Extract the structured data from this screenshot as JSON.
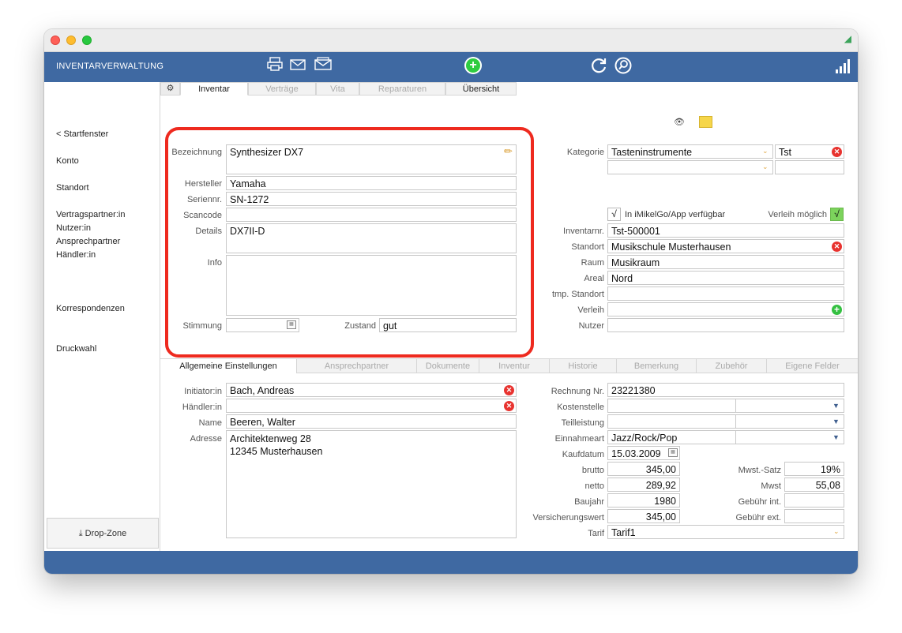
{
  "app": {
    "title": "INVENTARVERWALTUNG"
  },
  "sidebar": {
    "items": [
      "< Startfenster",
      "Konto",
      "Standort",
      "Vertragspartner:in",
      "Nutzer:in",
      "Ansprechpartner",
      "Händler:in",
      "Korrespondenzen",
      "Druckwahl"
    ],
    "dropzone": "Drop-Zone"
  },
  "tabs_top": [
    "Inventar",
    "Verträge",
    "Vita",
    "Reparaturen",
    "Übersicht"
  ],
  "form": {
    "bezeichnung_label": "Bezeichnung",
    "bezeichnung": "Synthesizer DX7",
    "hersteller_label": "Hersteller",
    "hersteller": "Yamaha",
    "seriennr_label": "Seriennr.",
    "seriennr": "SN-1272",
    "scancode_label": "Scancode",
    "scancode": "",
    "details_label": "Details",
    "details": "DX7II-D",
    "info_label": "Info",
    "info": "",
    "stimmung_label": "Stimmung",
    "stimmung": "",
    "zustand_label": "Zustand",
    "zustand": "gut"
  },
  "right": {
    "kategorie_label": "Kategorie",
    "kategorie": "Tasteninstrumente",
    "kategorie_code": "Tst",
    "app_check": "√",
    "app_label": "In iMikelGo/App verfügbar",
    "verleih_label": "Verleih möglich",
    "verleih_check": "√",
    "inventarnr_label": "Inventarnr.",
    "inventarnr": "Tst-500001",
    "standort_label": "Standort",
    "standort": "Musikschule Musterhausen",
    "raum_label": "Raum",
    "raum": "Musikraum",
    "areal_label": "Areal",
    "areal": "Nord",
    "tmp_label": "tmp. Standort",
    "tmp": "",
    "verleih2_label": "Verleih",
    "verleih2": "",
    "nutzer_label": "Nutzer",
    "nutzer": ""
  },
  "lower_tabs": [
    "Allgemeine Einstellungen",
    "Ansprechpartner",
    "Dokumente",
    "Inventur",
    "Historie",
    "Bemerkung",
    "Zubehör",
    "Eigene Felder"
  ],
  "lower": {
    "initiator_label": "Initiator:in",
    "initiator": "Bach, Andreas",
    "haendler_label": "Händler:in",
    "haendler": "",
    "name_label": "Name",
    "name": "Beeren, Walter",
    "adresse_label": "Adresse",
    "adresse_line1": "Architektenweg 28",
    "adresse_line2": "12345 Musterhausen",
    "rechnung_label": "Rechnung Nr.",
    "rechnung": "23221380",
    "kostenstelle_label": "Kostenstelle",
    "teilleistung_label": "Teilleistung",
    "einnahmeart_label": "Einnahmeart",
    "einnahmeart": "Jazz/Rock/Pop",
    "kaufdatum_label": "Kaufdatum",
    "kaufdatum": "15.03.2009",
    "brutto_label": "brutto",
    "brutto": "345,00",
    "netto_label": "netto",
    "netto": "289,92",
    "baujahr_label": "Baujahr",
    "baujahr": "1980",
    "versicherung_label": "Versicherungswert",
    "versicherung": "345,00",
    "tarif_label": "Tarif",
    "tarif": "Tarif1",
    "mwst_satz_label": "Mwst.-Satz",
    "mwst_satz": "19%",
    "mwst_label": "Mwst",
    "mwst": "55,08",
    "gebuehr_int_label": "Gebühr int.",
    "gebuehr_ext_label": "Gebühr ext."
  },
  "colors": {
    "accent": "#3f69a2",
    "highlight": "#ee2a1f",
    "green": "#34c041",
    "red": "#e8332f"
  },
  "icons": [
    "lock-icon",
    "printer-icon",
    "mail-icon",
    "mail-open-icon",
    "add-circle-icon",
    "refresh-icon",
    "search-icon",
    "signal-bars-icon",
    "gear-icon",
    "eye-icon",
    "note-icon",
    "pencil-icon",
    "download-icon"
  ]
}
